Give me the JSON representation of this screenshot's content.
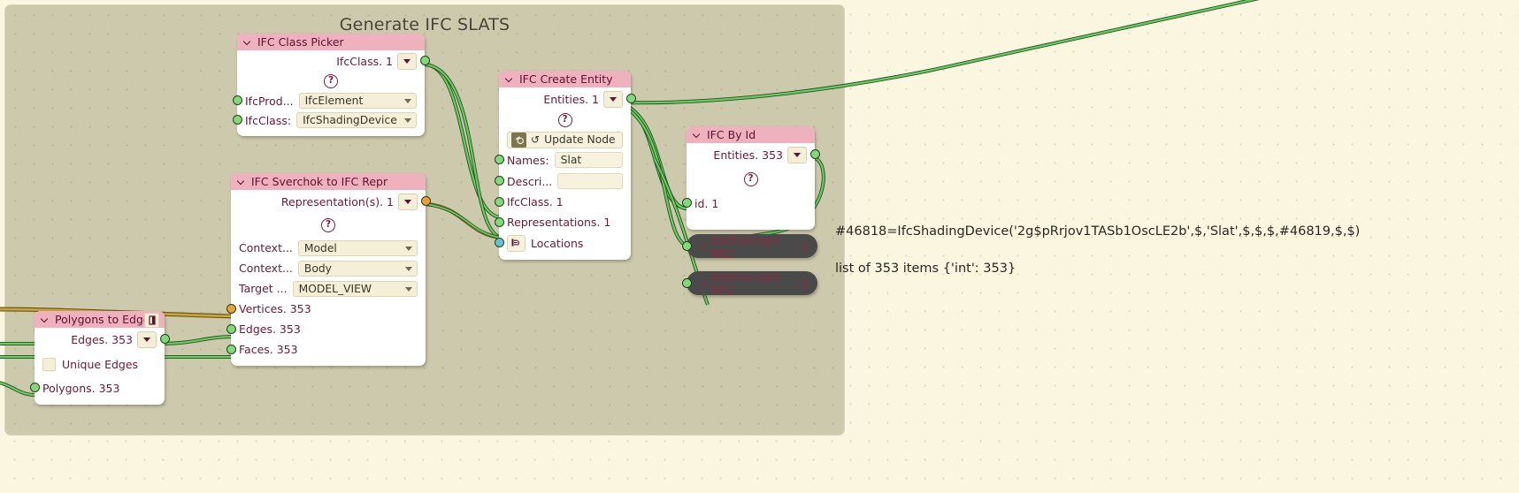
{
  "frame": {
    "title": "Generate IFC SLATS"
  },
  "nodes": {
    "ifc_class_picker": {
      "title": "IFC Class Picker",
      "outputs": [
        {
          "label": "IfcClass. 1"
        }
      ],
      "help": "?",
      "props": [
        {
          "label": "IfcProd...",
          "value": "IfcElement"
        },
        {
          "label": "IfcClass:",
          "value": "IfcShadingDevice"
        }
      ]
    },
    "ifc_create_entity": {
      "title": "IFC Create Entity",
      "outputs": [
        {
          "label": "Entities. 1"
        }
      ],
      "help": "?",
      "update_label": "Update Node",
      "inputs": [
        {
          "label": "Names:",
          "value": "Slat",
          "kind": "text"
        },
        {
          "label": "Descri...",
          "value": "",
          "kind": "text"
        },
        {
          "label": "IfcClass. 1",
          "kind": "plain"
        },
        {
          "label": "Representations. 1",
          "kind": "plain"
        },
        {
          "label": "Locations",
          "kind": "icon"
        }
      ]
    },
    "ifc_by_id": {
      "title": "IFC By Id",
      "outputs": [
        {
          "label": "Entities. 353"
        }
      ],
      "help": "?",
      "inputs": [
        {
          "label": "id. 1"
        }
      ]
    },
    "ifc_sverchok_to_ifc_repr": {
      "title": "IFC Sverchok to IFC Repr",
      "outputs": [
        {
          "label": "Representation(s). 1"
        }
      ],
      "help": "?",
      "props": [
        {
          "label": "Context...",
          "value": "Model"
        },
        {
          "label": "Context...",
          "value": "Body"
        },
        {
          "label": "Target ...",
          "value": "MODEL_VIEW"
        }
      ],
      "inputs": [
        {
          "label": "Vertices. 353"
        },
        {
          "label": "Edges. 353"
        },
        {
          "label": "Faces. 353"
        }
      ]
    },
    "polygons_to_edges": {
      "title": "Polygons to Edges",
      "outputs": [
        {
          "label": "Edges. 353"
        }
      ],
      "checkbox": {
        "label": "Unique Edges",
        "checked": false
      },
      "inputs": [
        {
          "label": "Polygons. 353"
        }
      ]
    },
    "stethoscope_1": {
      "title": "Stethoscope MK2"
    },
    "stethoscope_2": {
      "title": "Stethoscope MK2"
    }
  },
  "annotations": [
    {
      "text": "#46818=IfcShadingDevice('2g$pRrjov1TASb1OscLE2b',$,'Slat',$,$,$,#46819,$,$)"
    },
    {
      "text": "list of 353 items {'int': 353}"
    }
  ],
  "colors": {
    "node_header": "#efb1bd",
    "node_body": "#ffffff",
    "frame": "#c9c4a7",
    "canvas": "#fbf6e0",
    "wire_green": "#5fd25a",
    "wire_orange": "#c49a2e",
    "socket_green": "#7ddc78",
    "socket_cyan": "#55c9d6",
    "socket_orange": "#eda22b",
    "text_pink": "#6b1833",
    "stethoscope_bg": "#4a4a4a"
  }
}
